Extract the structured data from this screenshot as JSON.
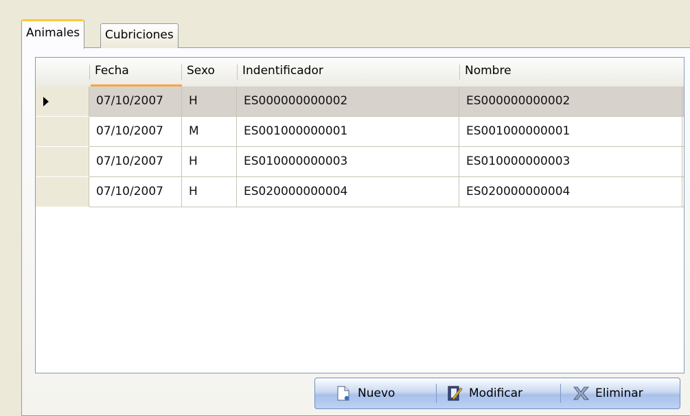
{
  "tabs": [
    {
      "label": "Animales",
      "active": true
    },
    {
      "label": "Cubriciones",
      "active": false
    }
  ],
  "grid": {
    "columns": [
      "Fecha",
      "Sexo",
      "Indentificador",
      "Nombre"
    ],
    "rows": [
      {
        "fecha": "07/10/2007",
        "sexo": "H",
        "identificador": "ES000000000002",
        "nombre": "ES000000000002",
        "selected": true
      },
      {
        "fecha": "07/10/2007",
        "sexo": "M",
        "identificador": "ES001000000001",
        "nombre": "ES001000000001",
        "selected": false
      },
      {
        "fecha": "07/10/2007",
        "sexo": "H",
        "identificador": "ES010000000003",
        "nombre": "ES010000000003",
        "selected": false
      },
      {
        "fecha": "07/10/2007",
        "sexo": "H",
        "identificador": "ES020000000004",
        "nombre": "ES020000000004",
        "selected": false
      }
    ]
  },
  "toolbar": {
    "nuevo_label": "Nuevo",
    "modificar_label": "Modificar",
    "eliminar_label": "Eliminar"
  },
  "icons": {
    "nuevo": "new-document-icon",
    "modificar": "edit-document-icon",
    "eliminar": "delete-x-icon"
  },
  "colors": {
    "selected_row": "#d8d2cd",
    "active_tab_accent": "#ffc83c",
    "sort_indicator": "#f9a53a"
  }
}
